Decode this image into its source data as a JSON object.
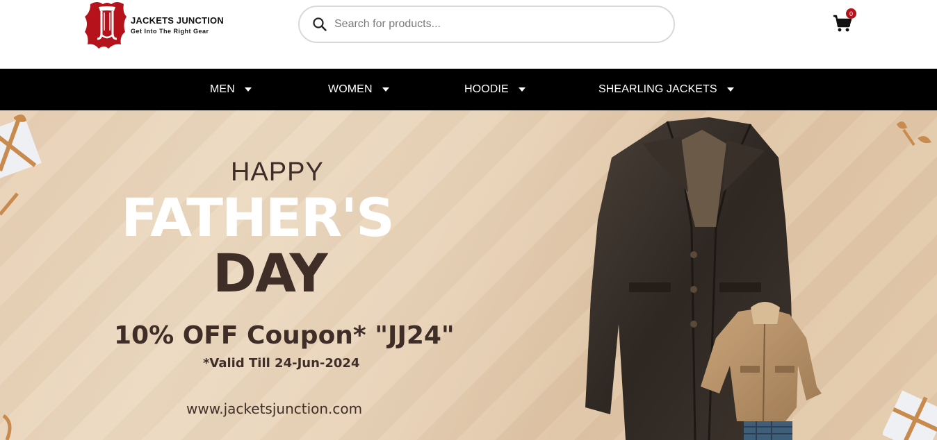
{
  "header": {
    "logo": {
      "name": "JACKETS JUNCTION",
      "tagline": "Get Into The Right Gear"
    },
    "search": {
      "placeholder": "Search for products..."
    },
    "cart": {
      "count": "0"
    }
  },
  "nav": {
    "items": [
      {
        "label": "MEN"
      },
      {
        "label": "WOMEN"
      },
      {
        "label": "HOODIE"
      },
      {
        "label": "SHEARLING JACKETS"
      }
    ]
  },
  "banner": {
    "happy": "HAPPY",
    "fathers": "FATHER'S",
    "day": "DAY",
    "coupon": "10% OFF Coupon* \"JJ24\"",
    "valid": "*Valid Till 24-Jun-2024",
    "website": "www.jacketsjunction.com"
  },
  "colors": {
    "brand_red": "#b5121b",
    "nav_bg": "#000000",
    "banner_text": "#3f2d28"
  }
}
